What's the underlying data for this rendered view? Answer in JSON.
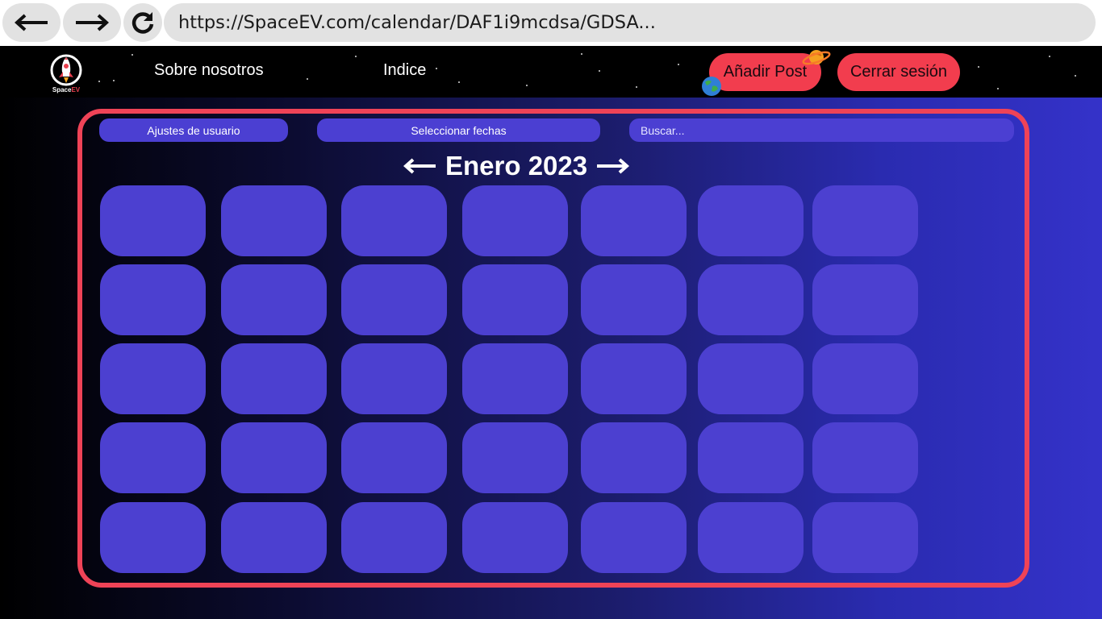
{
  "browser": {
    "url": "https://SpaceEV.com/calendar/DAF1i9mcdsa/GDSA..."
  },
  "header": {
    "logo": {
      "brand": "Space",
      "brand_accent": "EV"
    },
    "nav": {
      "about": "Sobre nosotros",
      "index": "Indice"
    },
    "add_post_label": "Añadir Post",
    "logout_label": "Cerrar sesión"
  },
  "controls": {
    "user_settings_label": "Ajustes de usuario",
    "select_dates_label": "Seleccionar fechas",
    "search_placeholder": "Buscar..."
  },
  "calendar": {
    "month_title": "Enero 2023",
    "rows": 5,
    "columns": 7
  },
  "colors": {
    "accent_red": "#f23d4e",
    "panel_border": "#ef4357",
    "cell_fill": "#4c40d0"
  },
  "icons": [
    "back-arrow-icon",
    "forward-arrow-icon",
    "reload-icon",
    "rocket-logo-icon",
    "planet-icon",
    "earth-icon",
    "left-arrow-icon",
    "right-arrow-icon"
  ]
}
